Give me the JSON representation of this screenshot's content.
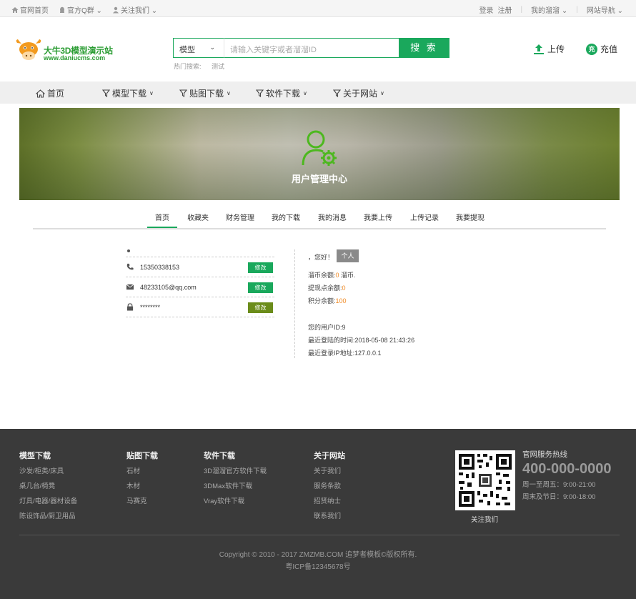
{
  "topbar": {
    "left": [
      {
        "label": "官网首页",
        "icon": "home-icon"
      },
      {
        "label": "官方Q群",
        "icon": "qq-icon"
      },
      {
        "label": "关注我们",
        "icon": "user-icon"
      }
    ],
    "login": "登录",
    "register": "注册",
    "my_zone": "我的溜溜",
    "site_nav": "网站导航"
  },
  "logo": {
    "title": "大牛3D模型演示站",
    "url": "www.daniucms.com"
  },
  "search": {
    "category": "模型",
    "placeholder": "请输入关键字或者溜溜ID",
    "button": "搜 索",
    "hot_label": "热门搜索:",
    "hot_terms": [
      "测试"
    ]
  },
  "header_actions": {
    "upload": "上传",
    "recharge": "充值",
    "recharge_icon_text": "充"
  },
  "nav": [
    {
      "label": "首页",
      "icon": "home-icon"
    },
    {
      "label": "模型下载",
      "icon": "filter-icon"
    },
    {
      "label": "贴图下载",
      "icon": "filter-icon"
    },
    {
      "label": "软件下载",
      "icon": "filter-icon"
    },
    {
      "label": "关于网站",
      "icon": "filter-icon"
    }
  ],
  "banner": {
    "title": "用户管理中心",
    "icon": "user-gear-icon"
  },
  "tabs": [
    "首页",
    "收藏夹",
    "财务管理",
    "我的下载",
    "我的消息",
    "我要上传",
    "上传记录",
    "我要提现"
  ],
  "active_tab": "首页",
  "account": {
    "phone": "15350338153",
    "email": "48233105@qq.com",
    "password": "********",
    "modify": "修改"
  },
  "profile": {
    "greeting": "，您好！",
    "badge": "个人",
    "coin_label": "溜币余额:",
    "coin_value": "0",
    "coin_unit": "溜币.",
    "withdraw_label": "提现点余额:",
    "withdraw_value": "0",
    "points_label": "积分余额:",
    "points_value": "100",
    "user_id": "您的用户ID:9",
    "last_login_time": "最近登陆的时间:2018-05-08 21:43:26",
    "last_login_ip": "最近登录IP地址:127.0.0.1"
  },
  "footer": {
    "columns": [
      {
        "title": "模型下载",
        "links": [
          "沙发/柜类/床具",
          "桌几台/椅凳",
          "灯具/电器/器材设备",
          "陈设饰品/厨卫用品"
        ]
      },
      {
        "title": "贴图下载",
        "links": [
          "石材",
          "木材",
          "马赛克"
        ]
      },
      {
        "title": "软件下载",
        "links": [
          "3D溜溜官方软件下载",
          "3DMax软件下载",
          "Vray软件下载"
        ]
      },
      {
        "title": "关于网站",
        "links": [
          "关于我们",
          "服务条款",
          "招贤纳士",
          "联系我们"
        ]
      }
    ],
    "qr_label": "关注我们",
    "hotline_title": "官网服务热线",
    "hotline_number": "400-000-0000",
    "hours_weekday": "周一至周五：9:00-21:00",
    "hours_weekend": "周末及节日：9:00-18:00",
    "copyright": "Copyright © 2010 - 2017 ZMZMB.COM 追梦者模板©版权所有.",
    "icp": "粤ICP备12345678号"
  },
  "colors": {
    "accent": "#1aa85c",
    "orange": "#f08a24",
    "footer_bg": "#3a3a3a"
  }
}
